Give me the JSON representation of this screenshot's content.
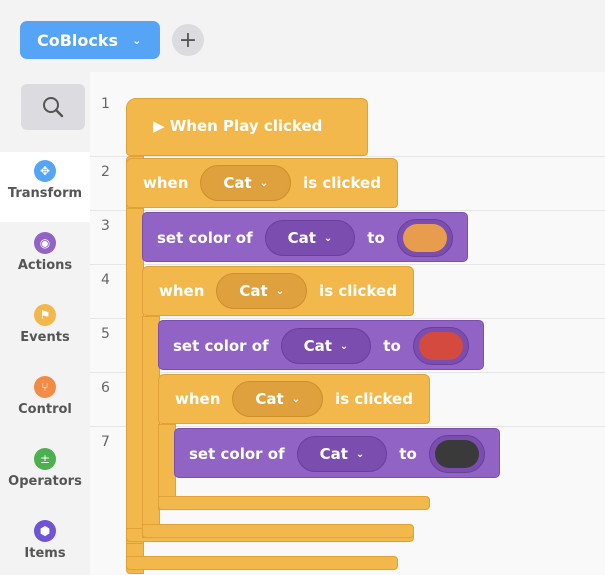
{
  "toolbar": {
    "project_label": "CoBlocks",
    "project_chevron": "⌄",
    "add_label": "+"
  },
  "sidebar": {
    "items": [
      {
        "label": "Transform",
        "icon": "move-icon",
        "color": "#56a4f5",
        "active": true
      },
      {
        "label": "Actions",
        "icon": "eye-icon",
        "color": "#9063c5",
        "active": false
      },
      {
        "label": "Events",
        "icon": "flag-icon",
        "color": "#f2b84b",
        "active": false
      },
      {
        "label": "Control",
        "icon": "branch-icon",
        "color": "#f28b46",
        "active": false
      },
      {
        "label": "Operators",
        "icon": "math-icon",
        "color": "#4caf50",
        "active": false
      },
      {
        "label": "Items",
        "icon": "box-icon",
        "color": "#6f55d6",
        "active": false
      }
    ]
  },
  "code": {
    "line_numbers": [
      "1",
      "2",
      "3",
      "4",
      "5",
      "6",
      "7"
    ],
    "hat": {
      "label": "▶ When Play clicked"
    },
    "when_blocks": [
      {
        "when": "when",
        "sprite": "Cat",
        "clicked": "is clicked"
      },
      {
        "when": "when",
        "sprite": "Cat",
        "clicked": "is clicked"
      },
      {
        "when": "when",
        "sprite": "Cat",
        "clicked": "is clicked"
      }
    ],
    "set_blocks": [
      {
        "label": "set color of",
        "sprite": "Cat",
        "to": "to",
        "color": "#e79c4e"
      },
      {
        "label": "set color of",
        "sprite": "Cat",
        "to": "to",
        "color": "#d44a3f"
      },
      {
        "label": "set color of",
        "sprite": "Cat",
        "to": "to",
        "color": "#3a3a3a"
      }
    ],
    "chevron": "⌄"
  }
}
